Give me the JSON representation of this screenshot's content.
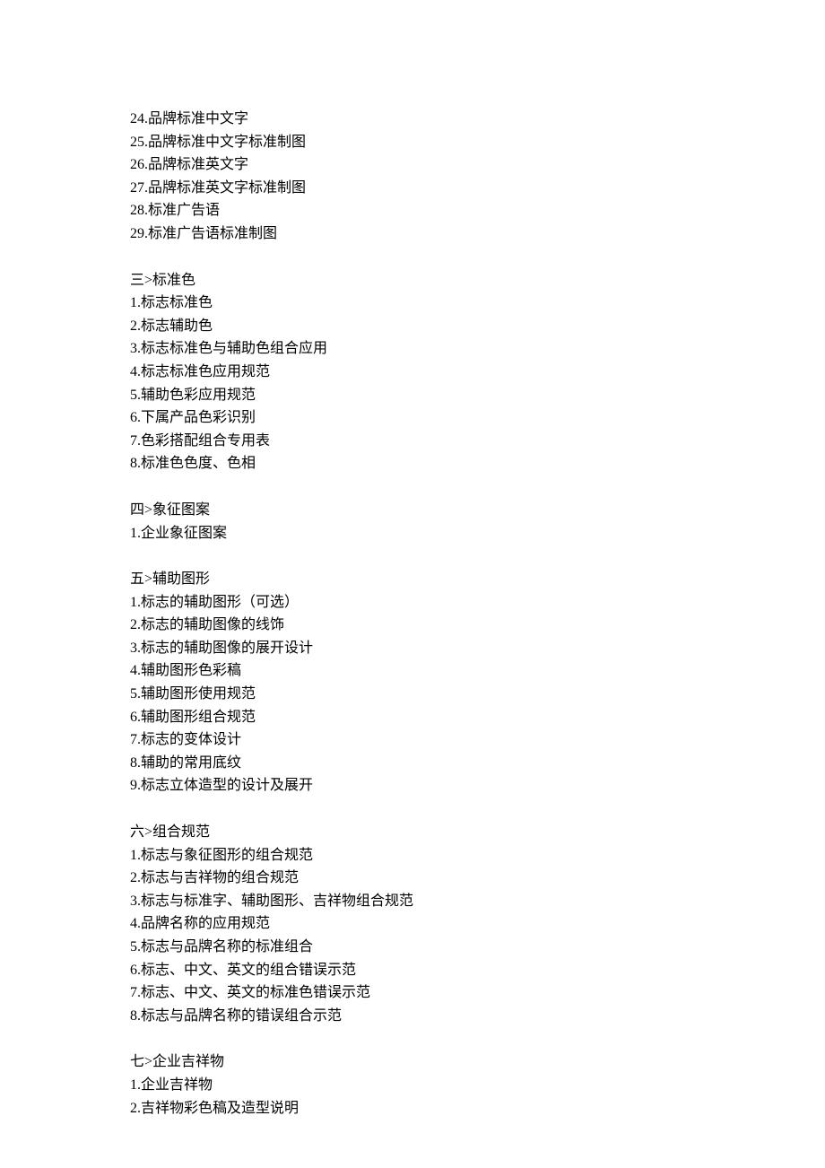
{
  "section_top": {
    "items": [
      "24.品牌标准中文字",
      "25.品牌标准中文字标准制图",
      "26.品牌标准英文字",
      "27.品牌标准英文字标准制图",
      "28.标准广告语",
      "29.标准广告语标准制图"
    ]
  },
  "section3": {
    "header": "三>标准色",
    "items": [
      "1.标志标准色",
      "2.标志辅助色",
      "3.标志标准色与辅助色组合应用",
      "4.标志标准色应用规范",
      "5.辅助色彩应用规范",
      "6.下属产品色彩识别",
      "7.色彩搭配组合专用表",
      "8.标准色色度、色相"
    ]
  },
  "section4": {
    "header": "四>象征图案",
    "items": [
      "1.企业象征图案"
    ]
  },
  "section5": {
    "header": "五>辅助图形",
    "items": [
      "1.标志的辅助图形（可选）",
      "2.标志的辅助图像的线饰",
      "3.标志的辅助图像的展开设计",
      "4.辅助图形色彩稿",
      "5.辅助图形使用规范",
      "6.辅助图形组合规范",
      "7.标志的变体设计",
      "8.辅助的常用底纹",
      "9.标志立体造型的设计及展开"
    ]
  },
  "section6": {
    "header": "六>组合规范",
    "items": [
      "1.标志与象征图形的组合规范",
      "2.标志与吉祥物的组合规范",
      "3.标志与标准字、辅助图形、吉祥物组合规范",
      "4.品牌名称的应用规范",
      "5.标志与品牌名称的标准组合",
      "6.标志、中文、英文的组合错误示范",
      "7.标志、中文、英文的标准色错误示范",
      "8.标志与品牌名称的错误组合示范"
    ]
  },
  "section7": {
    "header": "七>企业吉祥物",
    "items": [
      "1.企业吉祥物",
      "2.吉祥物彩色稿及造型说明"
    ]
  }
}
